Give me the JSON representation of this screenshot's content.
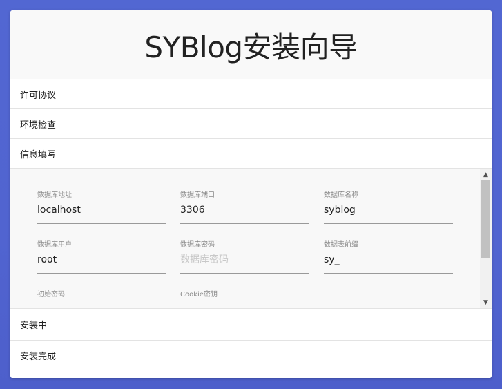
{
  "header": {
    "title": "SYBlog安装向导"
  },
  "steps": [
    {
      "label": "许可协议"
    },
    {
      "label": "环境检查"
    },
    {
      "label": "信息填写"
    },
    {
      "label": "安装中"
    },
    {
      "label": "安装完成"
    }
  ],
  "form": {
    "db_host": {
      "label": "数据库地址",
      "value": "localhost"
    },
    "db_port": {
      "label": "数据库端口",
      "value": "3306"
    },
    "db_name": {
      "label": "数据库名称",
      "value": "syblog"
    },
    "db_user": {
      "label": "数据库用户",
      "value": "root"
    },
    "db_password": {
      "label": "数据库密码",
      "value": "",
      "placeholder": "数据库密码"
    },
    "table_prefix": {
      "label": "数据表前缀",
      "value": "sy_"
    },
    "init_password": {
      "label": "初始密码"
    },
    "cookie_key": {
      "label": "Cookie密钥"
    }
  },
  "scrollbar": {
    "up_icon": "▲",
    "down_icon": "▼"
  }
}
